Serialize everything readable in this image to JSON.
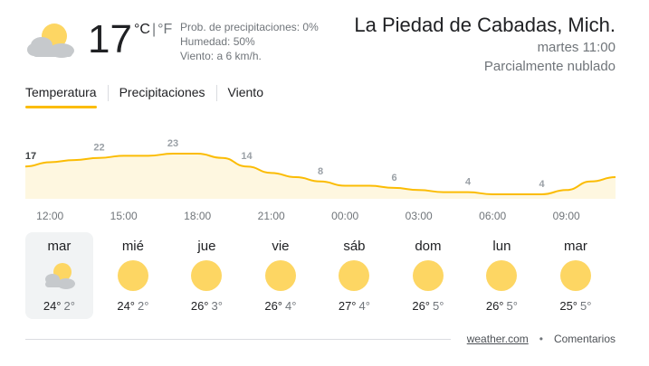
{
  "current": {
    "icon": "partly-cloudy-icon",
    "temperature": "17",
    "unit_c": "°C",
    "unit_sep": "|",
    "unit_f": "°F",
    "precipitation": "Prob. de precipitaciones: 0%",
    "humidity": "Humedad: 50%",
    "wind": "Viento: a 6 km/h."
  },
  "location": {
    "name": "La Piedad de Cabadas, Mich.",
    "time": "martes 11:00",
    "condition": "Parcialmente nublado"
  },
  "tabs": [
    {
      "label": "Temperatura",
      "active": true
    },
    {
      "label": "Precipitaciones",
      "active": false
    },
    {
      "label": "Viento",
      "active": false
    }
  ],
  "chart_data": {
    "type": "area",
    "x": [
      "11:00",
      "12:00",
      "13:00",
      "14:00",
      "15:00",
      "16:00",
      "17:00",
      "18:00",
      "19:00",
      "20:00",
      "21:00",
      "22:00",
      "23:00",
      "00:00",
      "01:00",
      "02:00",
      "03:00",
      "04:00",
      "05:00",
      "06:00",
      "07:00",
      "08:00",
      "09:00",
      "10:00",
      "11:00"
    ],
    "values": [
      17,
      19,
      20,
      21,
      22,
      22,
      23,
      23,
      21,
      17,
      14,
      12,
      10,
      8,
      8,
      7,
      6,
      5,
      5,
      4,
      4,
      4,
      6,
      10,
      12
    ],
    "labeled_points": [
      {
        "x": "11:00",
        "label": "17"
      },
      {
        "x": "14:00",
        "label": "22"
      },
      {
        "x": "17:00",
        "label": "23"
      },
      {
        "x": "20:00",
        "label": "14"
      },
      {
        "x": "23:00",
        "label": "8"
      },
      {
        "x": "02:00",
        "label": "6"
      },
      {
        "x": "05:00",
        "label": "4"
      },
      {
        "x": "08:00",
        "label": "4"
      }
    ],
    "tick_labels": [
      "12:00",
      "15:00",
      "18:00",
      "21:00",
      "00:00",
      "03:00",
      "06:00",
      "09:00"
    ],
    "line_color": "#fbbc04",
    "fill_color": "#fef7e0"
  },
  "days": [
    {
      "name": "mar",
      "icon": "partly-cloudy-icon",
      "high": "24°",
      "low": "2°",
      "active": true
    },
    {
      "name": "mié",
      "icon": "sun-icon",
      "high": "24°",
      "low": "2°",
      "active": false
    },
    {
      "name": "jue",
      "icon": "sun-icon",
      "high": "26°",
      "low": "3°",
      "active": false
    },
    {
      "name": "vie",
      "icon": "sun-icon",
      "high": "26°",
      "low": "4°",
      "active": false
    },
    {
      "name": "sáb",
      "icon": "sun-icon",
      "high": "27°",
      "low": "4°",
      "active": false
    },
    {
      "name": "dom",
      "icon": "sun-icon",
      "high": "26°",
      "low": "5°",
      "active": false
    },
    {
      "name": "lun",
      "icon": "sun-icon",
      "high": "26°",
      "low": "5°",
      "active": false
    },
    {
      "name": "mar",
      "icon": "sun-icon",
      "high": "25°",
      "low": "5°",
      "active": false
    }
  ],
  "footer": {
    "source": "weather.com",
    "separator": "•",
    "feedback": "Comentarios"
  },
  "colors": {
    "sun": "#fdd663",
    "accent": "#fbbc04",
    "cloud": "#c6c9cc"
  }
}
